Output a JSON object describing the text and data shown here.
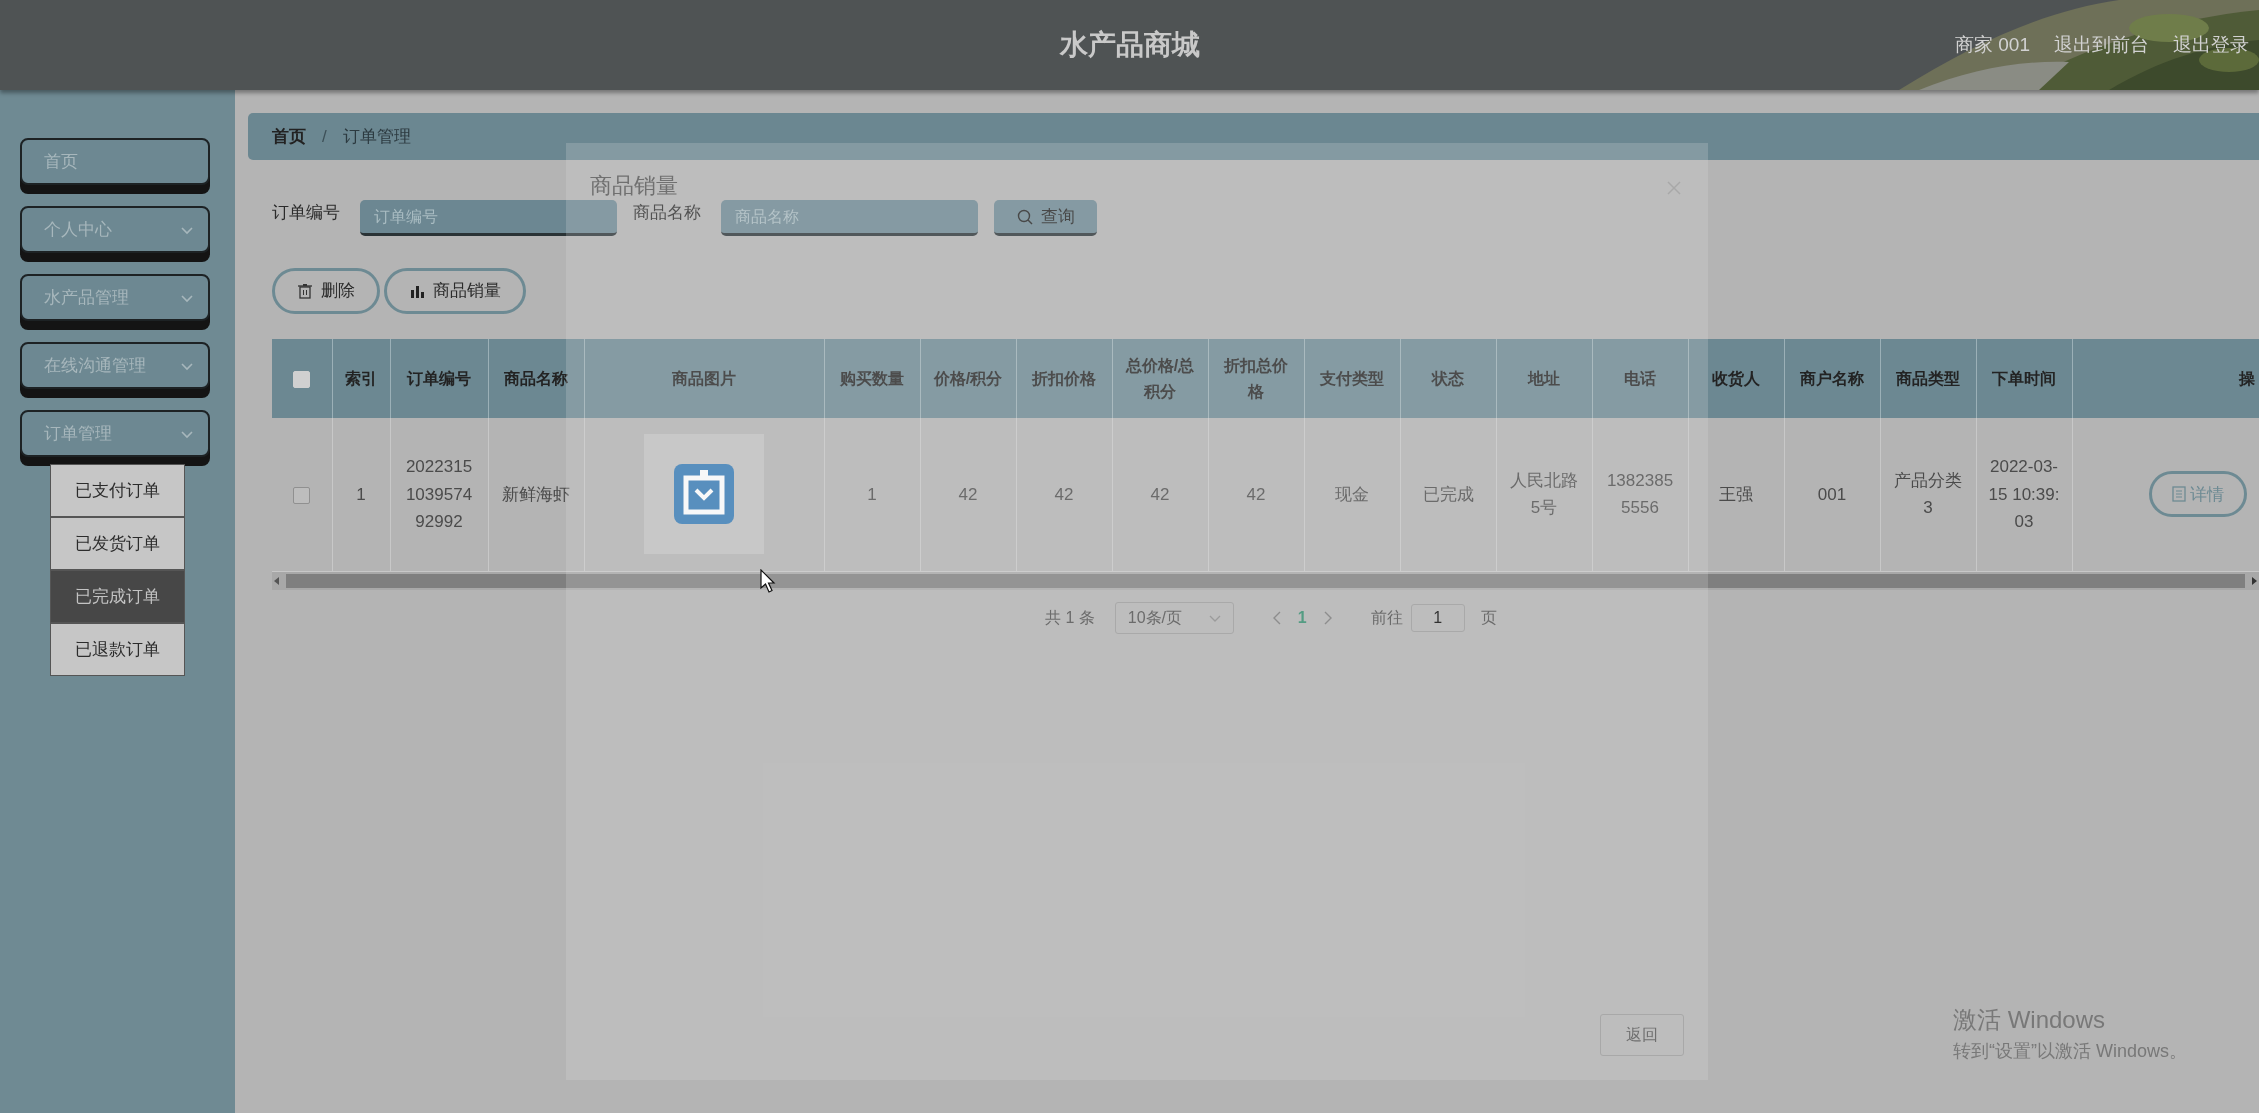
{
  "header": {
    "title": "水产品商城",
    "links": [
      "商家 001",
      "退出到前台",
      "退出登录"
    ]
  },
  "sidebar": {
    "items": [
      {
        "label": "首页",
        "kind": "link"
      },
      {
        "label": "个人中心",
        "kind": "menu"
      },
      {
        "label": "水产品管理",
        "kind": "menu"
      },
      {
        "label": "在线沟通管理",
        "kind": "menu"
      },
      {
        "label": "订单管理",
        "kind": "menu",
        "children": [
          {
            "label": "已支付订单",
            "selected": false
          },
          {
            "label": "已发货订单",
            "selected": false
          },
          {
            "label": "已完成订单",
            "selected": true
          },
          {
            "label": "已退款订单",
            "selected": false
          }
        ]
      }
    ]
  },
  "breadcrumb": {
    "items": [
      "首页",
      "订单管理"
    ],
    "separator": "/"
  },
  "search": {
    "fields": [
      {
        "label": "订单编号",
        "placeholder": "订单编号"
      },
      {
        "label": "商品名称",
        "placeholder": "商品名称"
      }
    ],
    "button": "查询"
  },
  "actions": [
    {
      "label": "删除"
    },
    {
      "label": "商品销量"
    }
  ],
  "table": {
    "select_all": {
      "checked": false
    },
    "columns": [
      {
        "label": "索引",
        "kind": "text"
      },
      {
        "label": "订单编号",
        "kind": "text"
      },
      {
        "label": "商品名称",
        "kind": "text"
      },
      {
        "label": "商品图片"
      },
      {
        "label": "购买数量",
        "kind": "text"
      },
      {
        "label": "价格/积分",
        "kind": "text"
      },
      {
        "label": "折扣价格",
        "kind": "text"
      },
      {
        "label": "总价格/总积分",
        "kind": "text"
      },
      {
        "label": "折扣总价格",
        "kind": "text"
      },
      {
        "label": "支付类型",
        "kind": "text"
      },
      {
        "label": "状态",
        "kind": "text"
      },
      {
        "label": "地址",
        "kind": "text"
      },
      {
        "label": "电话",
        "kind": "text"
      },
      {
        "label": "收货人",
        "kind": "text"
      },
      {
        "label": "商户名称",
        "kind": "text"
      },
      {
        "label": "商品类型",
        "kind": "text"
      },
      {
        "label": "下单时间",
        "kind": "text"
      },
      {
        "label": "操",
        "kind": "action"
      }
    ],
    "rows": [
      {
        "checked": false,
        "cells": [
          "1",
          "2022315103957492992",
          "新鲜海虾",
          {
            "kind": "picture"
          },
          "1",
          "42",
          "42",
          "42",
          "42",
          "现金",
          "已完成",
          "人民北路5号",
          "13823855556",
          "王强",
          "001",
          "产品分类3",
          "2022-03-15 10:39:03"
        ],
        "action": "详情"
      }
    ]
  },
  "pagination": {
    "total": "共 1 条",
    "page_size": "10条/页",
    "pages": [
      {
        "label": "1",
        "selected": true
      }
    ],
    "goto_label": "前往",
    "goto_value": "1",
    "goto_suffix": "页"
  },
  "dialog": {
    "title": "商品销量",
    "button": "返回"
  },
  "os_notice": {
    "title": "激活 Windows",
    "subtitle": "转到“设置”以激活 Windows。"
  }
}
